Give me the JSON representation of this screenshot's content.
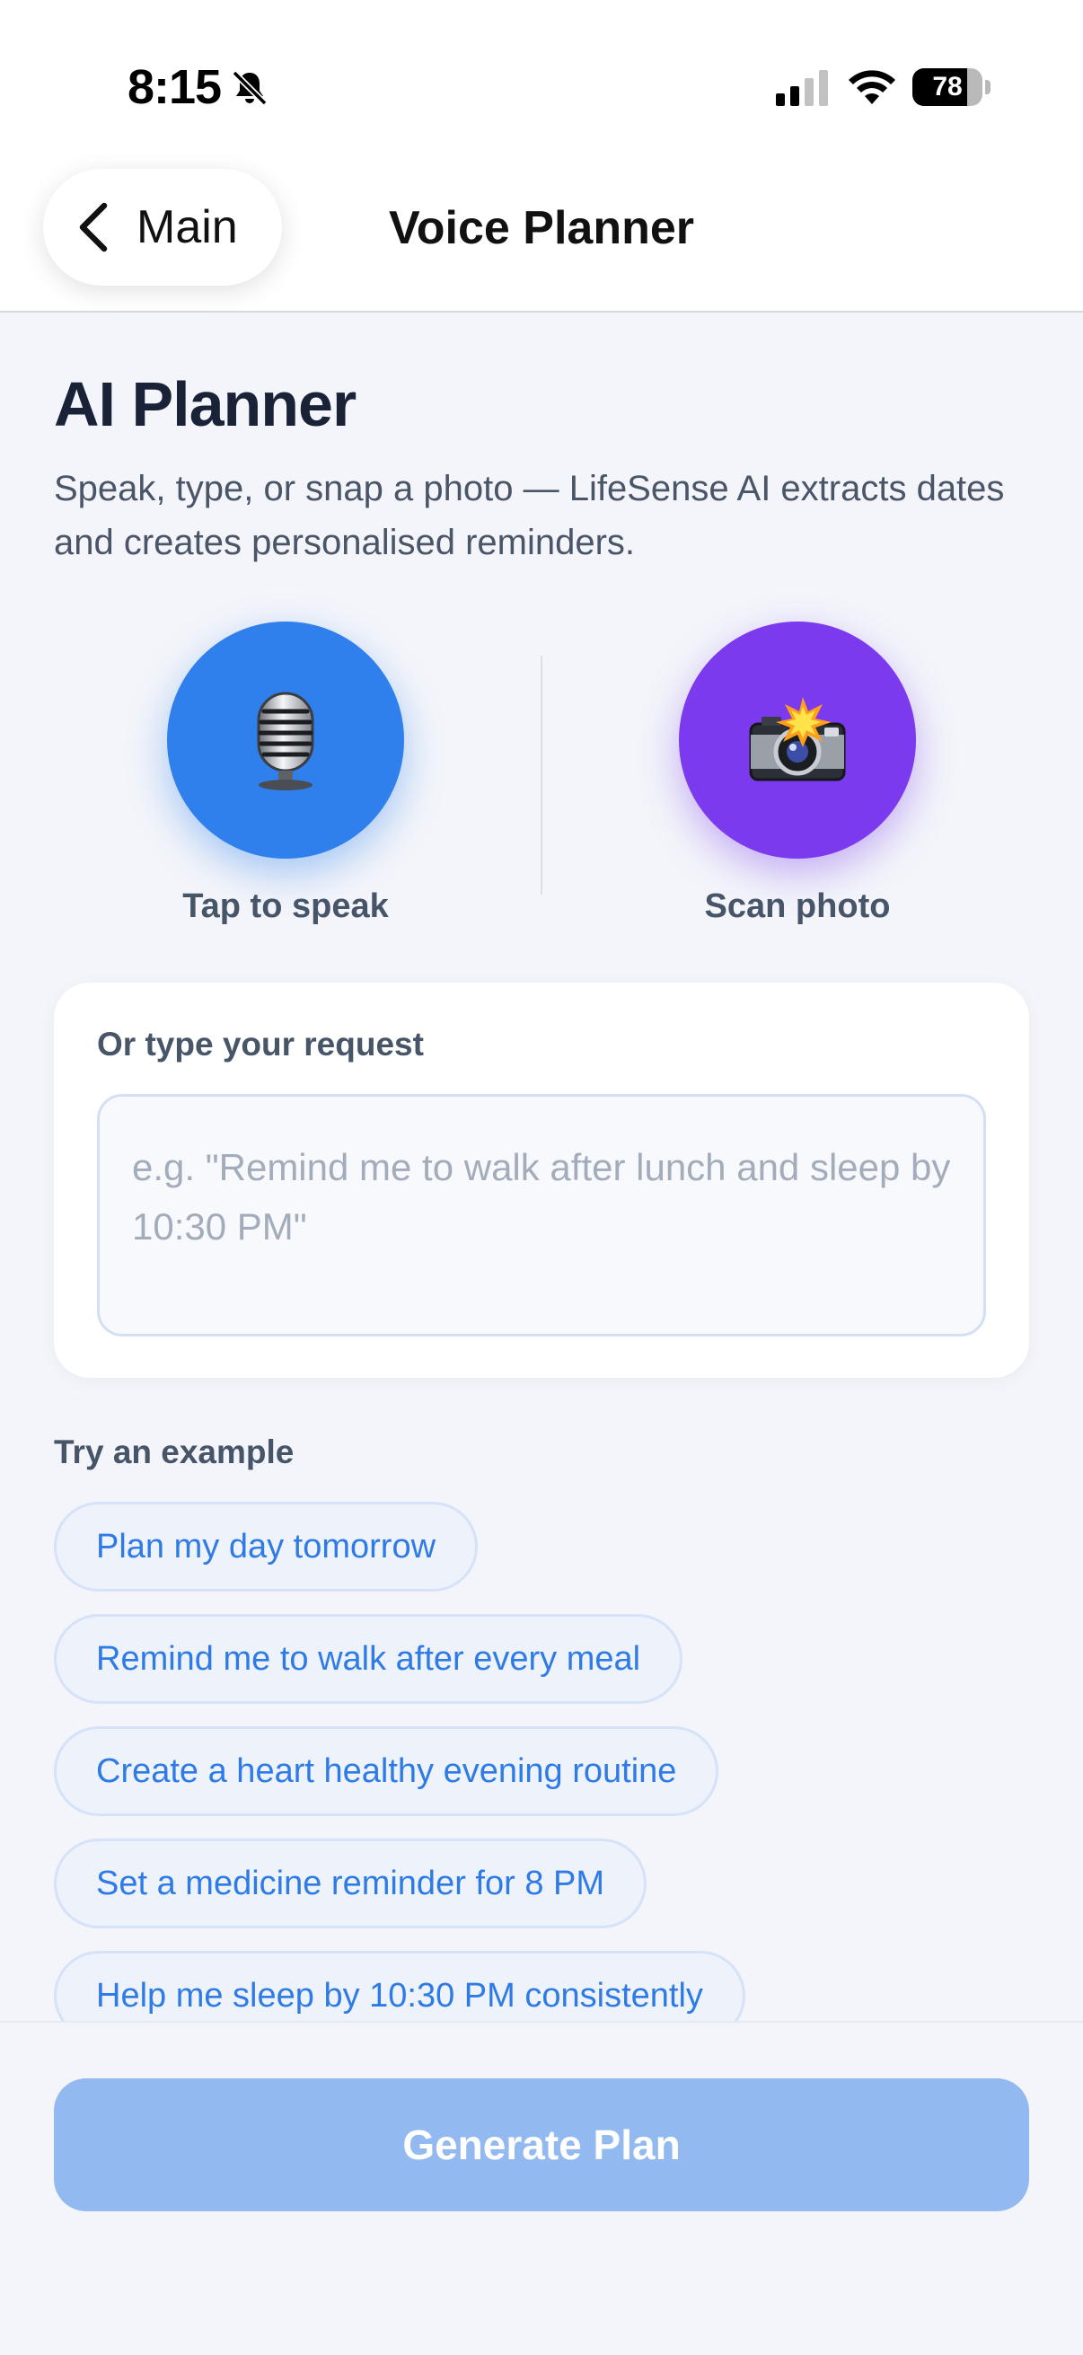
{
  "status_bar": {
    "time": "8:15",
    "battery_level": "78"
  },
  "nav": {
    "back_label": "Main",
    "title": "Voice Planner"
  },
  "header": {
    "title": "AI Planner",
    "subtitle": "Speak, type, or snap a photo — LifeSense AI extracts dates and creates personalised reminders."
  },
  "actions": {
    "speak": {
      "label": "Tap to speak",
      "icon": "microphone-icon",
      "color": "#2f80ed"
    },
    "scan": {
      "label": "Scan photo",
      "icon": "camera-flash-icon",
      "color": "#7b3aed"
    }
  },
  "request": {
    "label": "Or type your request",
    "value": "",
    "placeholder": "e.g. \"Remind me to walk after lunch and sleep by 10:30 PM\""
  },
  "examples": {
    "label": "Try an example",
    "items": [
      "Plan my day tomorrow",
      "Remind me to walk after every meal",
      "Create a heart healthy evening routine",
      "Set a medicine reminder for 8 PM",
      "Help me sleep by 10:30 PM consistently"
    ]
  },
  "footer": {
    "generate_label": "Generate Plan",
    "accent": "#93b9f1"
  }
}
